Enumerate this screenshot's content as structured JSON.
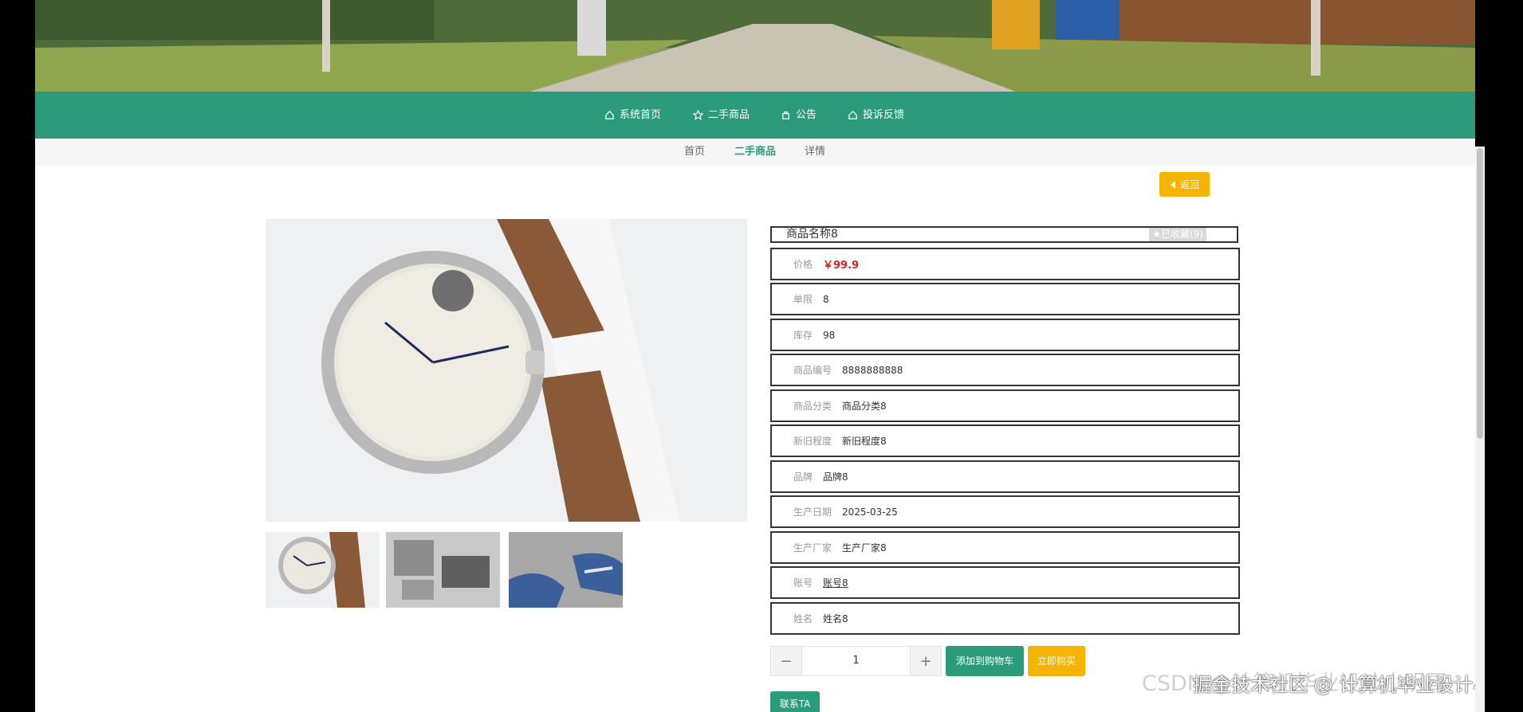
{
  "nav": {
    "items": [
      {
        "label": "系统首页",
        "icon": "home-icon"
      },
      {
        "label": "二手商品",
        "icon": "star-icon"
      },
      {
        "label": "公告",
        "icon": "bag-icon"
      },
      {
        "label": "投诉反馈",
        "icon": "home-icon"
      }
    ]
  },
  "breadcrumb": {
    "items": [
      "首页",
      "二手商品",
      "详情"
    ]
  },
  "back_label": "返回",
  "product": {
    "name": "商品名称8",
    "favorite_label": "已收藏(9)",
    "fields": [
      {
        "label": "价格",
        "value": "￥99.9"
      },
      {
        "label": "单限",
        "value": "8"
      },
      {
        "label": "库存",
        "value": "98"
      },
      {
        "label": "商品编号",
        "value": "8888888888"
      },
      {
        "label": "商品分类",
        "value": "商品分类8"
      },
      {
        "label": "新旧程度",
        "value": "新旧程度8"
      },
      {
        "label": "品牌",
        "value": "品牌8"
      },
      {
        "label": "生产日期",
        "value": "2025-03-25"
      },
      {
        "label": "生产厂家",
        "value": "生产厂家8"
      },
      {
        "label": "账号",
        "value": "账号8"
      },
      {
        "label": "姓名",
        "value": "姓名8"
      }
    ]
  },
  "quantity": {
    "value": "1",
    "minus": "−",
    "plus": "+"
  },
  "actions": {
    "add_to_cart": "添加到购物车",
    "buy_now": "立即购买",
    "contact": "联系TA"
  },
  "colors": {
    "primary": "#2b9b7b",
    "accent": "#f4b400",
    "price": "#d9232d"
  },
  "watermark": "掘金技术社区 @ 计算机毕业设计小明哥",
  "watermark_faint": "CSDN @计算机毕业设计小明哥"
}
